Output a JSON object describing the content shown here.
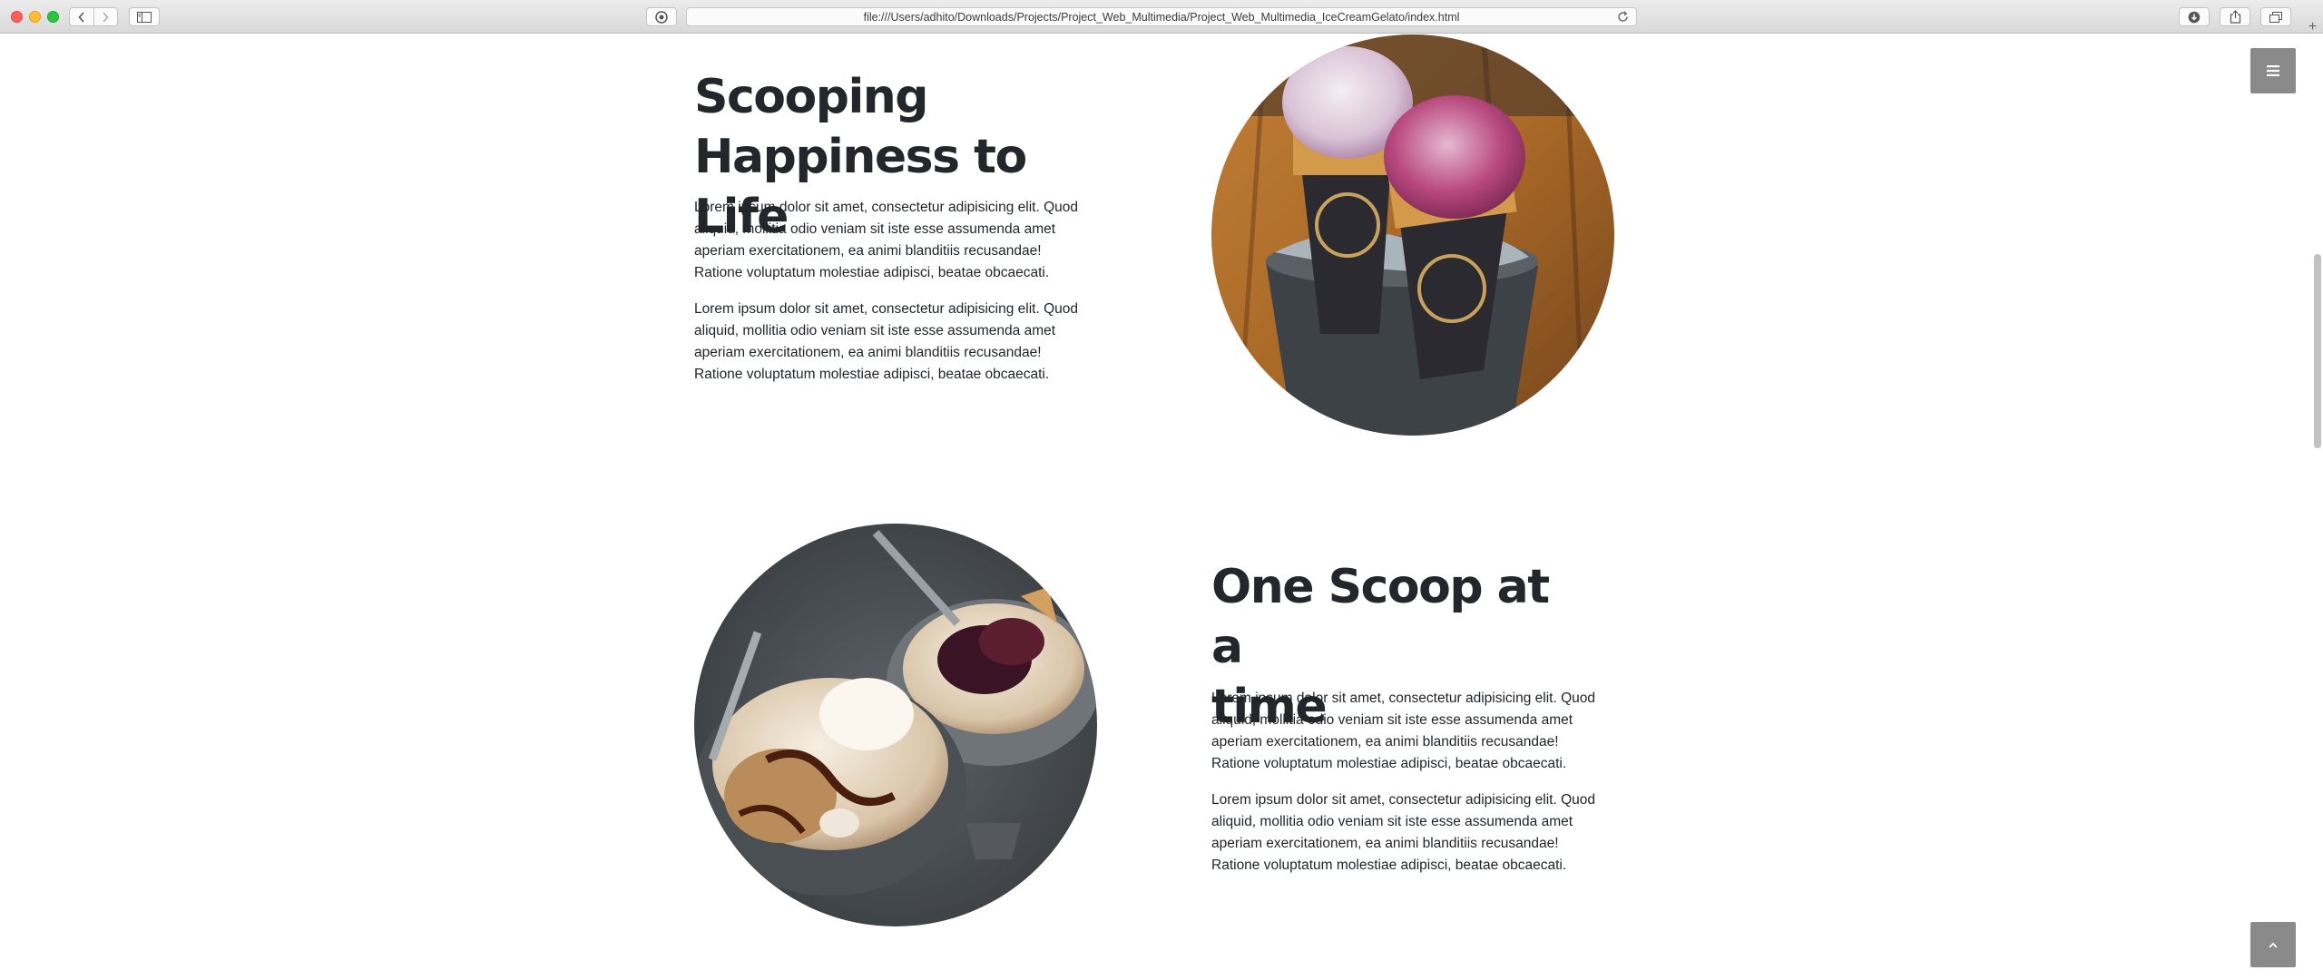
{
  "browser": {
    "url": "file:///Users/adhito/Downloads/Projects/Project_Web_Multimedia/Project_Web_Multimedia_IceCreamGelato/index.html"
  },
  "section_1": {
    "title_line1": "Scooping",
    "title_line2": "Happiness to Life",
    "paragraphs": [
      "Lorem ipsum dolor sit amet, consectetur adipisicing elit. Quod aliquid, mollitia odio veniam sit iste esse assumenda amet aperiam exercitationem, ea animi blanditiis recusandae! Ratione voluptatum molestiae adipisci, beatae obcaecati.",
      "Lorem ipsum dolor sit amet, consectetur adipisicing elit. Quod aliquid, mollitia odio veniam sit iste esse assumenda amet aperiam exercitationem, ea animi blanditiis recusandae! Ratione voluptatum molestiae adipisci, beatae obcaecati."
    ]
  },
  "section_2": {
    "title_line1": "One Scoop at a",
    "title_line2": "time",
    "paragraphs": [
      "Lorem ipsum dolor sit amet, consectetur adipisicing elit. Quod aliquid, mollitia odio veniam sit iste esse assumenda amet aperiam exercitationem, ea animi blanditiis recusandae! Ratione voluptatum molestiae adipisci, beatae obcaecati.",
      "Lorem ipsum dolor sit amet, consectetur adipisicing elit. Quod aliquid, mollitia odio veniam sit iste esse assumenda amet aperiam exercitationem, ea animi blanditiis recusandae! Ratione voluptatum molestiae adipisci, beatae obcaecati."
    ]
  },
  "icons": {
    "menu": "hamburger-menu-icon",
    "back_to_top": "chevron-up-icon"
  },
  "colors": {
    "heading": "#23262b",
    "text": "#1f2327",
    "floating_button": "#8a8a8a"
  }
}
